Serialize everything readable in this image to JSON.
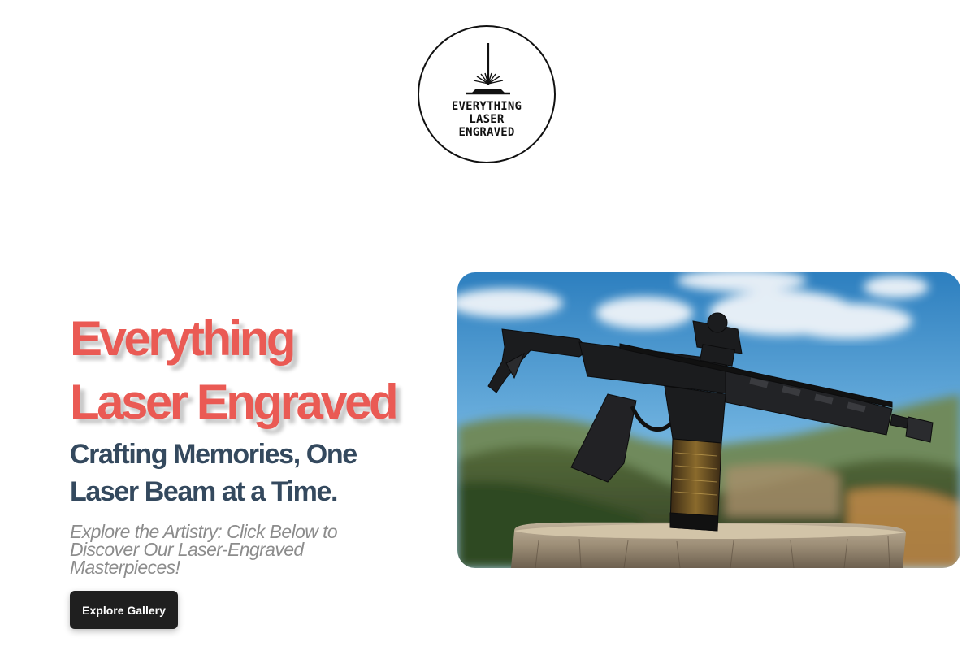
{
  "logo": {
    "line1": "EVERYTHING",
    "line2": "LASER",
    "line3": "ENGRAVED",
    "icon": "laser-beam-icon"
  },
  "hero": {
    "title_line1": "Everything",
    "title_line2": "Laser Engraved",
    "subtitle_line1": "Crafting Memories, One",
    "subtitle_line2": "Laser Beam at a Time.",
    "description_line1": "Explore the Artistry: Click Below to",
    "description_line2": "Discover Our Laser-Engraved",
    "description_line3": "Masterpieces!",
    "cta_label": "Explore Gallery",
    "image": "rifle-on-stump-photo"
  },
  "colors": {
    "title": "#ea5a54",
    "subtitle": "#34495e",
    "description": "#8c8c8c",
    "button": "#1f1f1f"
  }
}
